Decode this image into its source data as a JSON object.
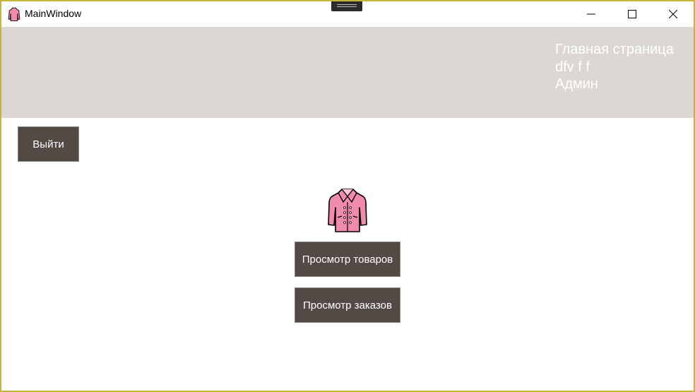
{
  "window": {
    "title": "MainWindow",
    "border_color": "#c8b436"
  },
  "titlebar": {
    "icon": "coat-icon",
    "minimize_icon": "minimize-icon",
    "maximize_icon": "maximize-icon",
    "close_icon": "close-icon"
  },
  "header": {
    "background": "#dbd8d3",
    "page_name": "Главная страница",
    "user_name": "dfv f f",
    "user_role": "Админ"
  },
  "buttons": {
    "exit_label": "Выйти",
    "view_products_label": "Просмотр товаров",
    "view_orders_label": "Просмотр заказов",
    "background": "#534a45"
  },
  "logo": {
    "icon": "coat-icon",
    "color": "#f08bab"
  }
}
